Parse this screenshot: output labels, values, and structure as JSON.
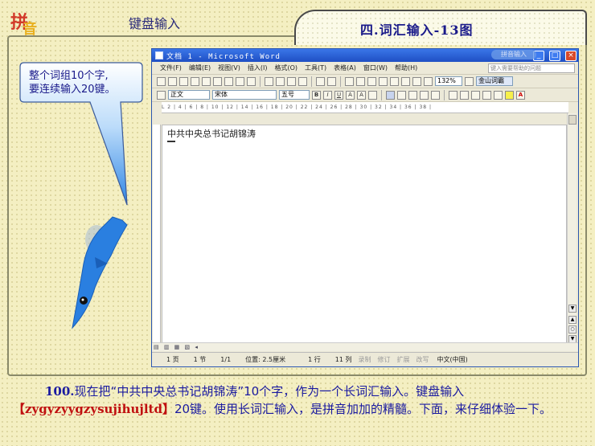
{
  "header": {
    "logo_char_1": "拼",
    "logo_char_2": "音",
    "title": "键盘输入",
    "tab_title": "四.词汇输入-13图"
  },
  "bubble": {
    "line1": "整个词组10个字,",
    "line2": "要连续输入20键。"
  },
  "word": {
    "title": "文档 1 - Microsoft Word",
    "badge": "拼音输入",
    "min": "_",
    "max": "□",
    "close": "×",
    "menu": [
      "文件(F)",
      "编辑(E)",
      "视图(V)",
      "插入(I)",
      "格式(O)",
      "工具(T)",
      "表格(A)",
      "窗口(W)",
      "帮助(H)"
    ],
    "help_placeholder": "键入需要帮助的问题",
    "zoom": "132%",
    "ime_label": "金山词霸",
    "style": "正文",
    "font": "宋体",
    "size": "五号",
    "ruler": "L  2 | 4 | 6 | 8 | 10 | 12 | 14 | 16 | 18 | 20 | 22 | 24 | 26 | 28 | 30 | 32 | 34 | 36 | 38 |",
    "doc_text": "中共中央总书记胡锦涛",
    "view_buttons": "▤ ▥ ▦ ▧ ◂",
    "status": {
      "page": "1 页",
      "section": "1 节",
      "pages": "1/1",
      "position": "位置: 2.5厘米",
      "line": "1 行",
      "col": "11 列",
      "rec": "录制",
      "trk": "修订",
      "ext": "扩展",
      "ovr": "改写",
      "lang": "中文(中国)"
    }
  },
  "caption": {
    "number": "100.",
    "part1": "现在把“中共中央总书记胡锦涛”10个字，作为一个长词汇输入。键盘输入",
    "code": "【zygyzyygzysujihujltd】",
    "part2": "20键。使用长词汇输入，是拼音加加的精髓。下面，来仔细体验一下。"
  },
  "colors": {
    "background": "#f4efc2",
    "bubble_fill": "#3a90e8",
    "dolphin": "#2a7fe0",
    "text_blue": "#1a1aa0",
    "titlebar": "#2a5fd0"
  }
}
